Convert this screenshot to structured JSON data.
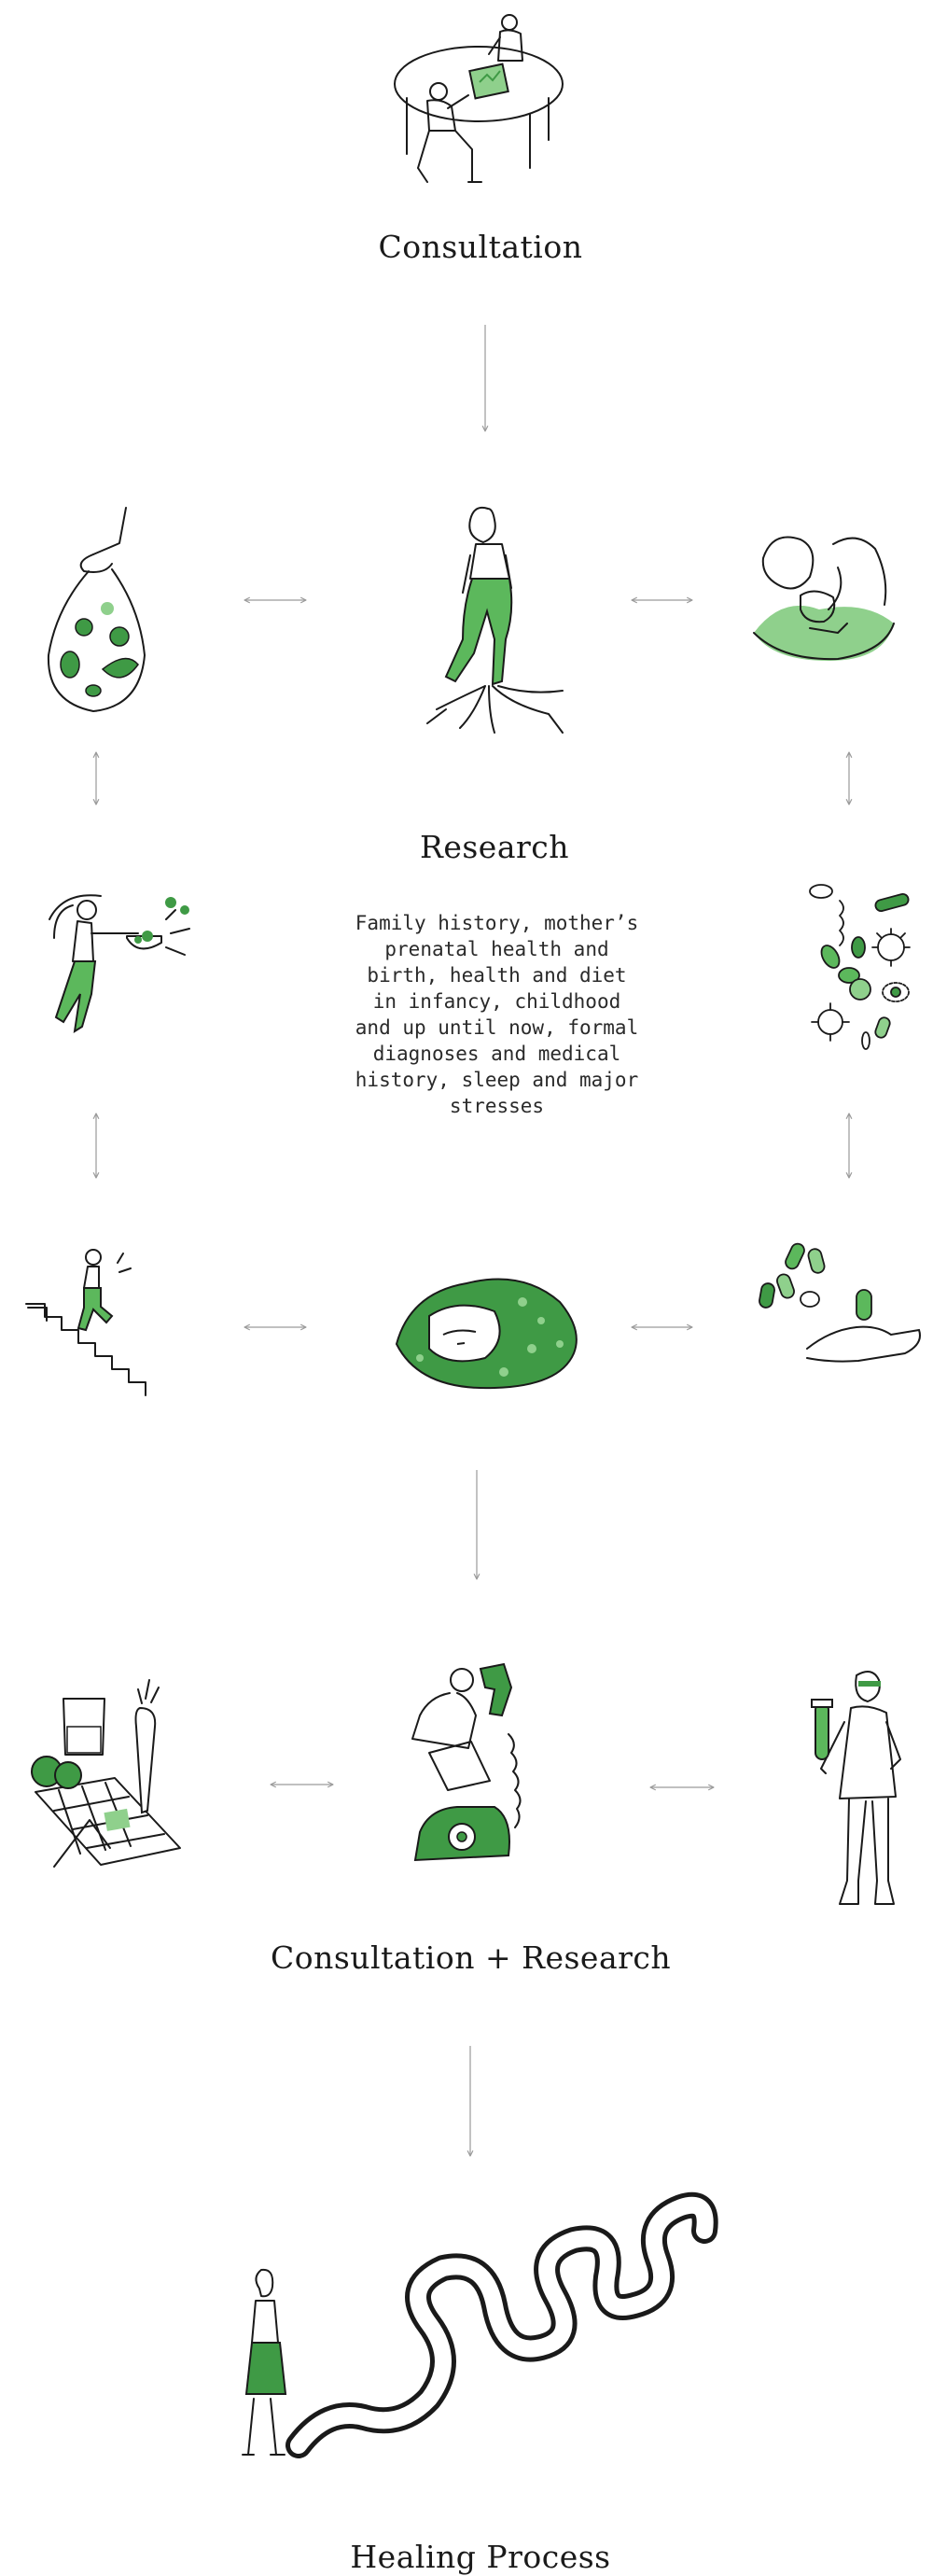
{
  "steps": {
    "consultation": {
      "title": "Consultation"
    },
    "research": {
      "title": "Research",
      "description": "Family history, mother’s\nprenatal health and\nbirth, health and diet\nin infancy, childhood\nand up until now, formal\ndiagnoses and medical\nhistory, sleep and major\nstresses"
    },
    "consultation_research": {
      "title": "Consultation + Research"
    },
    "healing_process": {
      "title": "Healing Process"
    }
  },
  "colors": {
    "accent_green": "#3f9a45",
    "light_green": "#8fd08c",
    "ink": "#1a1a1a",
    "arrow": "#9a9a9a"
  },
  "icons": [
    "consultation-table-icon",
    "grocery-bag-icon",
    "woman-roots-icon",
    "family-embrace-icon",
    "cooking-woman-icon",
    "microbes-icon",
    "stairs-runner-icon",
    "sleeping-person-icon",
    "pills-hand-icon",
    "diet-calendar-icon",
    "phone-call-icon",
    "lab-scientist-icon",
    "winding-path-icon"
  ]
}
